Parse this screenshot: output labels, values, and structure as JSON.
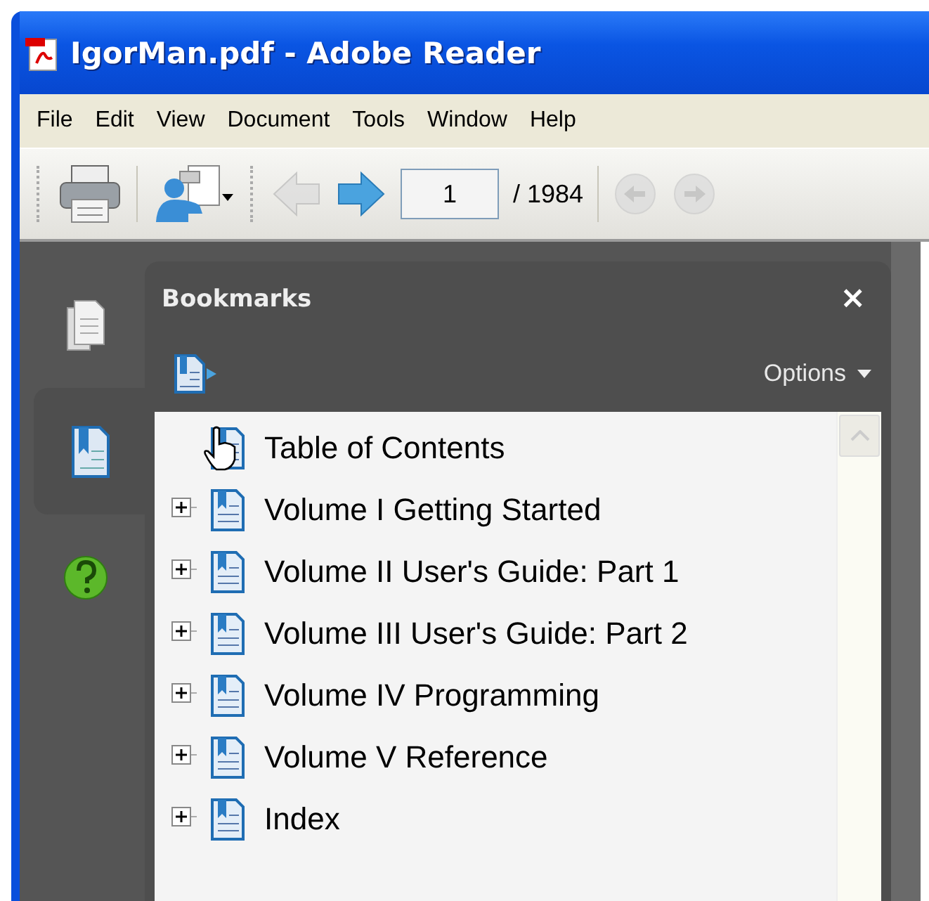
{
  "window": {
    "title": "IgorMan.pdf - Adobe Reader"
  },
  "menu": [
    "File",
    "Edit",
    "View",
    "Document",
    "Tools",
    "Window",
    "Help"
  ],
  "toolbar": {
    "buttons": [
      {
        "kind": "print",
        "disabled": false
      },
      {
        "kind": "share",
        "disabled": false
      },
      {
        "kind": "prev",
        "disabled": true
      },
      {
        "kind": "next",
        "disabled": false
      }
    ],
    "page": {
      "value": "1",
      "total": "/ 1984"
    },
    "view_buttons": [
      {
        "kind": "prev_view",
        "disabled": true
      },
      {
        "kind": "next_view",
        "disabled": true
      }
    ]
  },
  "nav_tabs": [
    {
      "kind": "pages",
      "selected": false
    },
    {
      "kind": "bookmarks",
      "selected": true
    },
    {
      "kind": "help",
      "selected": false
    }
  ],
  "bookmarks_panel": {
    "title": "Bookmarks",
    "close": "×",
    "options": "Options",
    "items": [
      {
        "label": "Table of Contents",
        "kind": "leaf"
      },
      {
        "label": "Volume I Getting Started",
        "kind": "node",
        "expanded": false
      },
      {
        "label": "Volume II User's Guide: Part 1",
        "kind": "node",
        "expanded": false
      },
      {
        "label": "Volume III User's Guide: Part 2",
        "kind": "node",
        "expanded": false
      },
      {
        "label": "Volume IV Programming",
        "kind": "node",
        "expanded": false
      },
      {
        "label": "Volume V Reference",
        "kind": "node",
        "expanded": false
      },
      {
        "label": "Index",
        "kind": "node",
        "expanded": false
      }
    ]
  }
}
